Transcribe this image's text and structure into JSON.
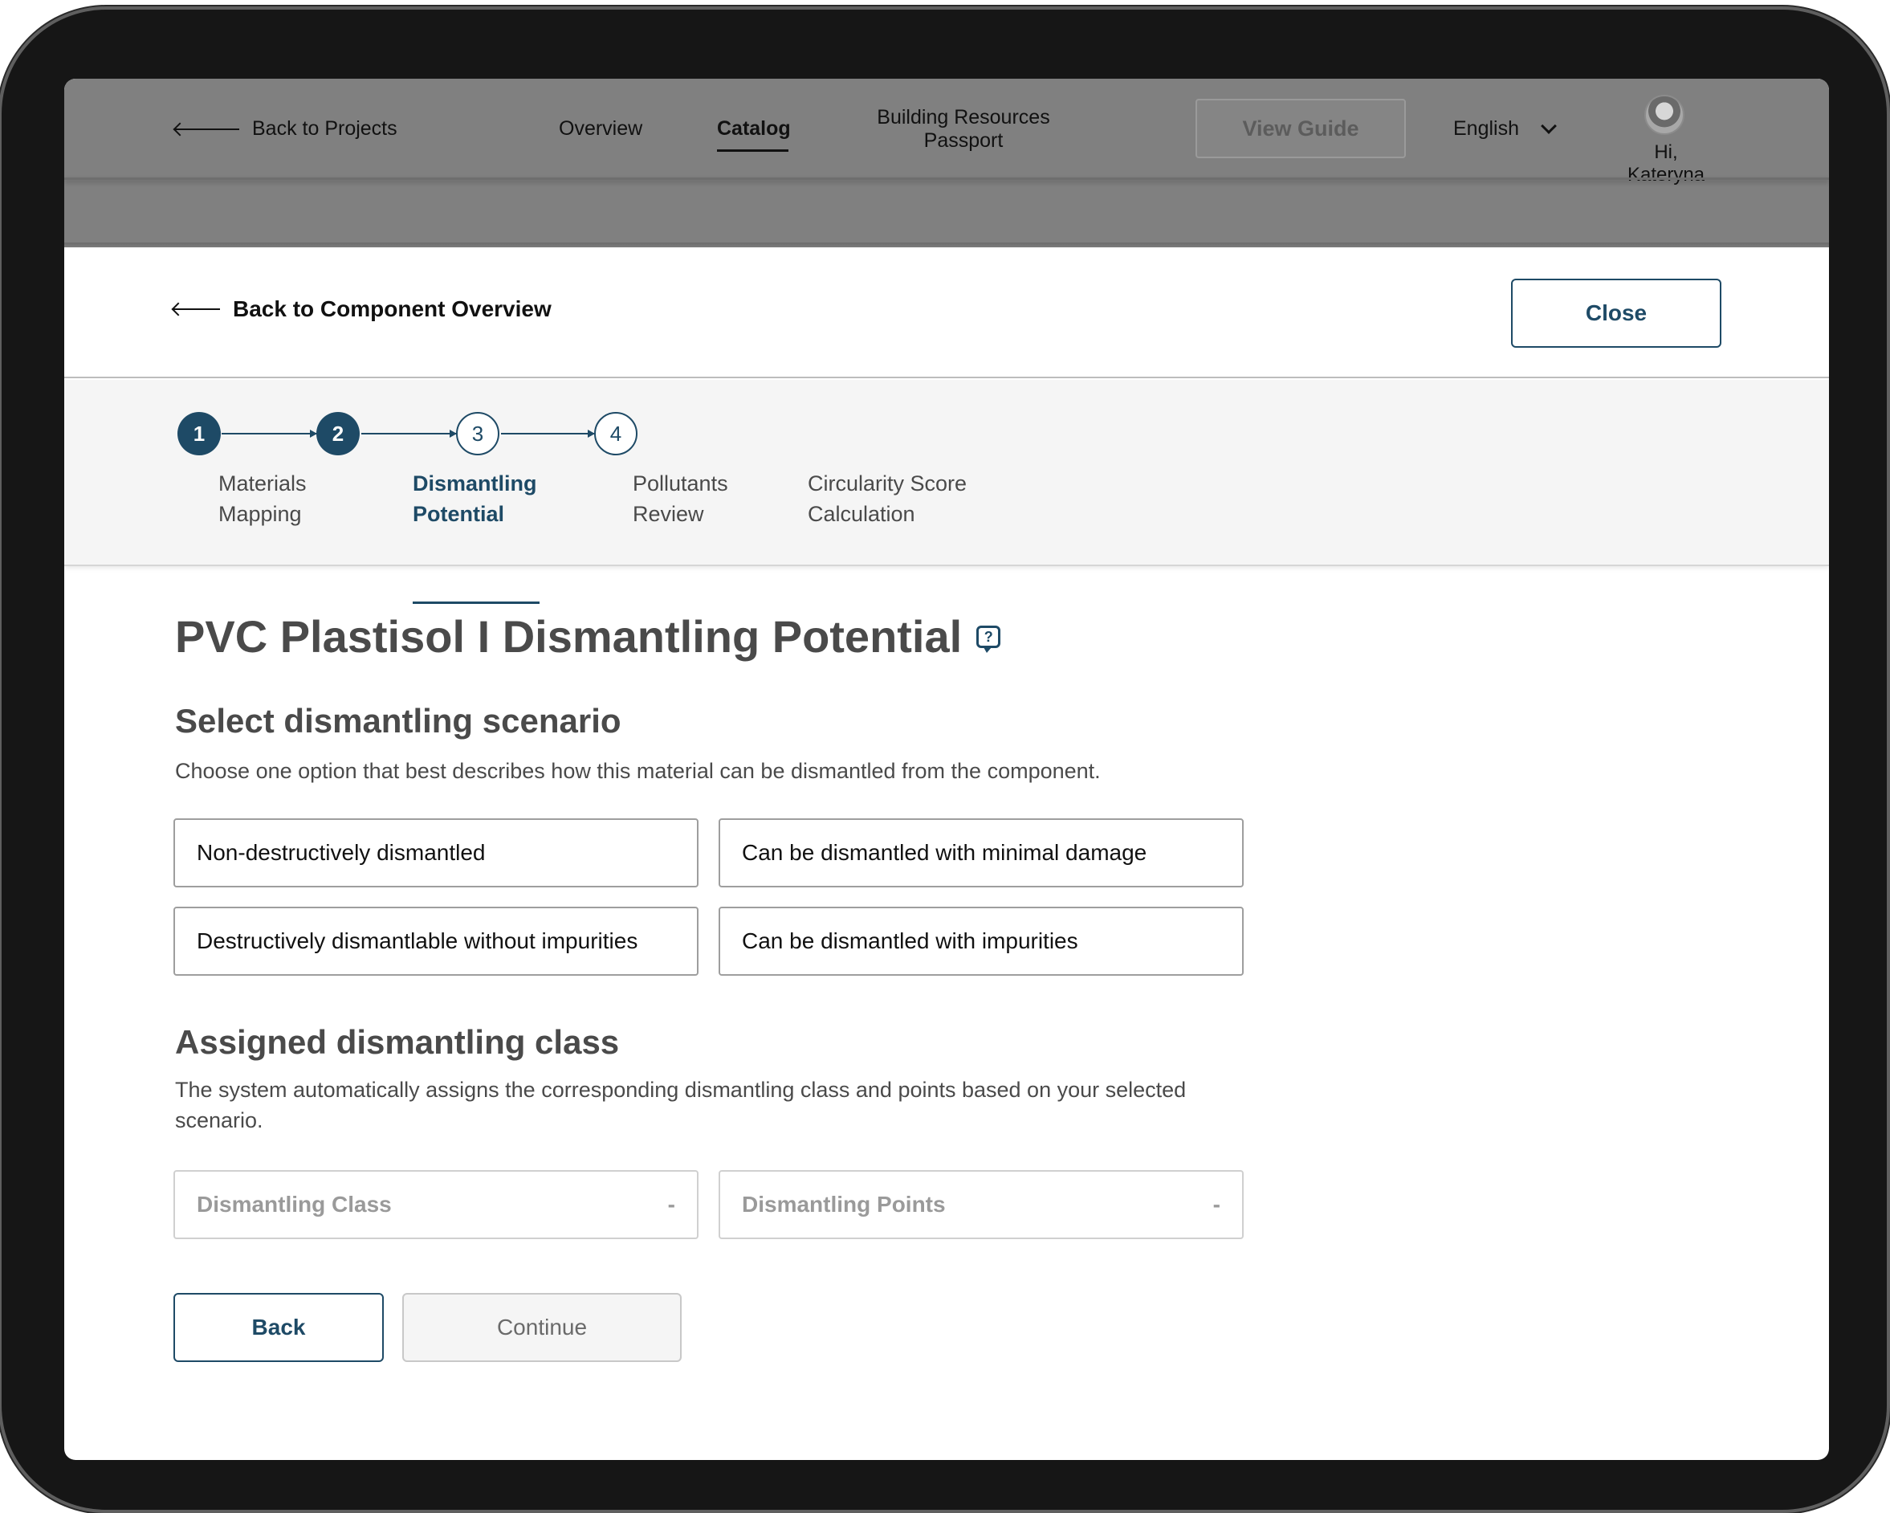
{
  "topbar": {
    "back_label": "Back to Projects",
    "nav": {
      "overview": "Overview",
      "catalog": "Catalog",
      "brp": "Building Resources Passport"
    },
    "view_guide": "View Guide",
    "language": "English",
    "greeting": "Hi, Kateryna"
  },
  "subheader": {
    "back_label": "Back to Component Overview",
    "close_label": "Close"
  },
  "stepper": {
    "steps": [
      {
        "number": "1",
        "line1": "Materials",
        "line2": "Mapping",
        "state": "done"
      },
      {
        "number": "2",
        "line1": "Dismantling",
        "line2": "Potential",
        "state": "active"
      },
      {
        "number": "3",
        "line1": "Pollutants",
        "line2": "Review",
        "state": "todo"
      },
      {
        "number": "4",
        "line1": "Circularity Score",
        "line2": "Calculation",
        "state": "todo"
      }
    ]
  },
  "main": {
    "title": "PVC Plastisol I Dismantling Potential",
    "help_icon_glyph": "?",
    "scenario": {
      "title": "Select dismantling scenario",
      "description": "Choose one option that best describes how this material can be dismantled from the component.",
      "options": [
        "Non-destructively dismantled",
        "Can be dismantled with minimal damage",
        "Destructively dismantlable without impurities",
        "Can be dismantled with impurities"
      ]
    },
    "assigned": {
      "title": "Assigned dismantling class",
      "description": "The system automatically assigns the corresponding dismantling class and points based on your selected scenario.",
      "class_label": "Dismantling Class",
      "class_value": "-",
      "points_label": "Dismantling Points",
      "points_value": "-"
    },
    "buttons": {
      "back": "Back",
      "continue": "Continue"
    }
  },
  "colors": {
    "accent": "#1e4a66",
    "overlay": "#808080",
    "frame": "#161616"
  },
  "icons": [
    "arrow-left-icon",
    "chevron-down-icon",
    "help-bubble-icon",
    "avatar-photo"
  ]
}
